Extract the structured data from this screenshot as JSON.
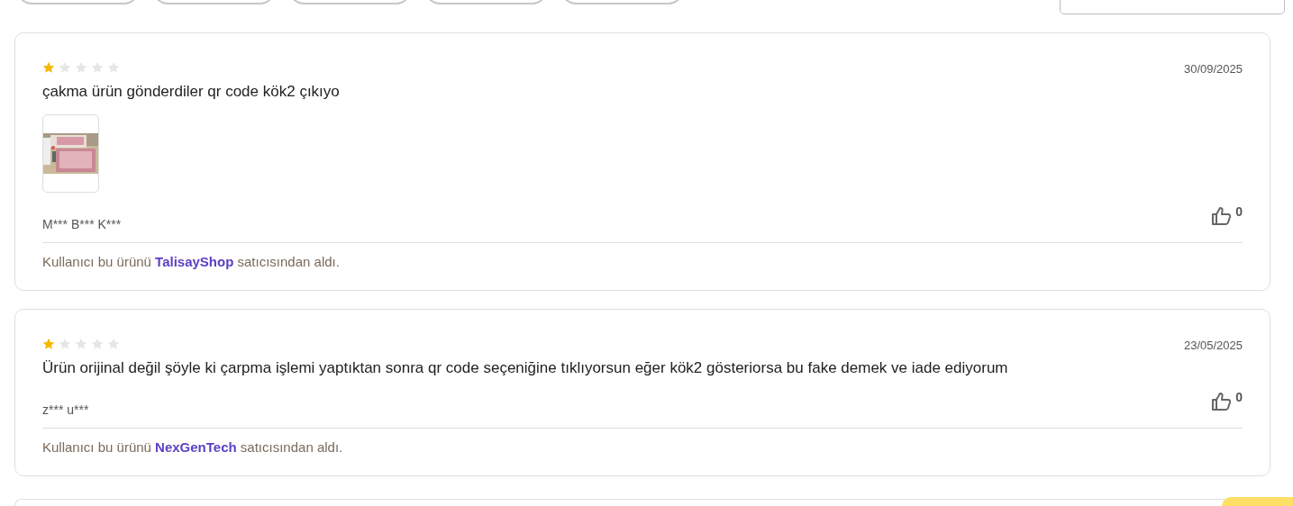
{
  "reviews": [
    {
      "stars": 1,
      "date": "30/09/2025",
      "text": "çakma ürün gönderdiler qr code kök2 çıkıyo",
      "images": [
        {
          "kind": "picture"
        }
      ],
      "author": "M*** B*** K***",
      "likes": "0",
      "purchase_prefix": "Kullanıcı bu ürünü",
      "seller": "TalisayShop",
      "purchase_suffix": "satıcısından aldı."
    },
    {
      "stars": 1,
      "date": "23/05/2025",
      "text": "Ürün orijinal değil şöyle ki çarpma işlemi yaptıktan sonra qr code seçeniğine tıklıyorsun eğer kök2 gösteriorsa bu fake demek ve iade ediyorum",
      "author": "z*** u***",
      "likes": "0",
      "purchase_prefix": "Kullanıcı bu ürünü",
      "seller": "NexGenTech",
      "purchase_suffix": "satıcısından aldı."
    }
  ]
}
